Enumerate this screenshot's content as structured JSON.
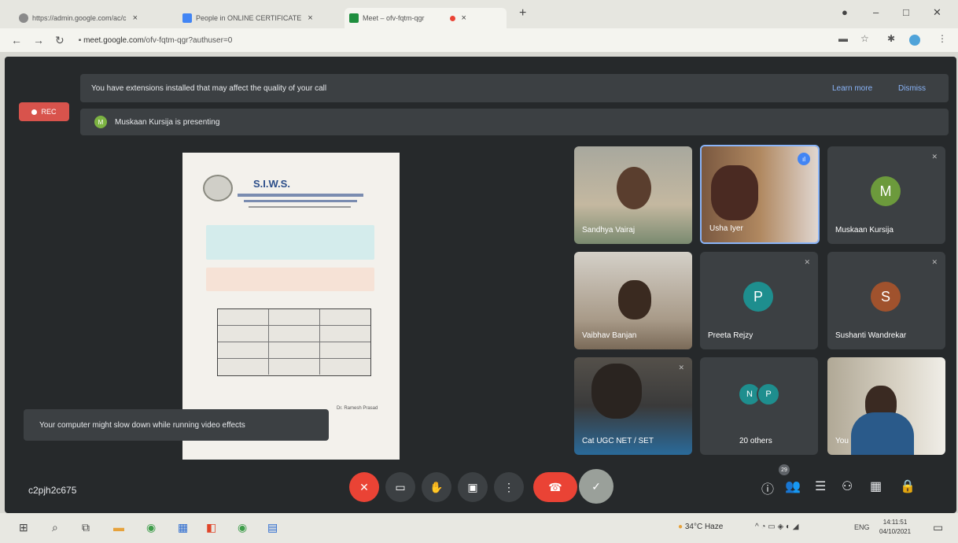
{
  "browser": {
    "tabs": [
      {
        "label": "https://admin.google.com/ac/c",
        "color": "#8a8a8a"
      },
      {
        "label": "People in ONLINE CERTIFICATE",
        "color": "#4285f4"
      },
      {
        "label": "Meet – ofv-fqtm-qgr",
        "color": "#1e8e3e"
      }
    ],
    "new_tab": "+",
    "url_host": "meet.google.com",
    "url_path": "/ofv-fqtm-qgr?authuser=0"
  },
  "meet": {
    "rec_label": "REC",
    "ext_banner": {
      "message": "You have extensions installed that may affect the quality of your call",
      "learn_more": "Learn more",
      "dismiss": "Dismiss"
    },
    "presenting": {
      "avatar_letter": "M",
      "text": "Muskaan Kursija is presenting"
    },
    "document": {
      "title": "S.I.W.S.",
      "signature": "Dr. Ramesh Prasad"
    },
    "tiles": [
      {
        "name": "Sandhya Vairaj",
        "type": "video"
      },
      {
        "name": "Usha Iyer",
        "type": "video",
        "speaking": true
      },
      {
        "name": "Muskaan Kursija",
        "type": "avatar",
        "letter": "M",
        "color": "#6c9a3c"
      },
      {
        "name": "Vaibhav Banjan",
        "type": "video"
      },
      {
        "name": "Preeta Rejzy",
        "type": "avatar",
        "letter": "P",
        "color": "#1e8e8e"
      },
      {
        "name": "Sushanti Wandrekar",
        "type": "avatar",
        "letter": "S",
        "color": "#a0522d"
      },
      {
        "name": "Cat UGC NET / SET",
        "type": "video"
      },
      {
        "name": "20 others",
        "type": "others",
        "letters": [
          "N",
          "P"
        ]
      },
      {
        "name": "You",
        "type": "video"
      }
    ],
    "toast": "Your computer might slow down while running video effects",
    "meeting_code": "c2pjh2c675",
    "participant_count": "29"
  },
  "taskbar": {
    "weather": "34°C Haze",
    "lang": "ENG",
    "time": "14:11:51",
    "date": "04/10/2021"
  }
}
